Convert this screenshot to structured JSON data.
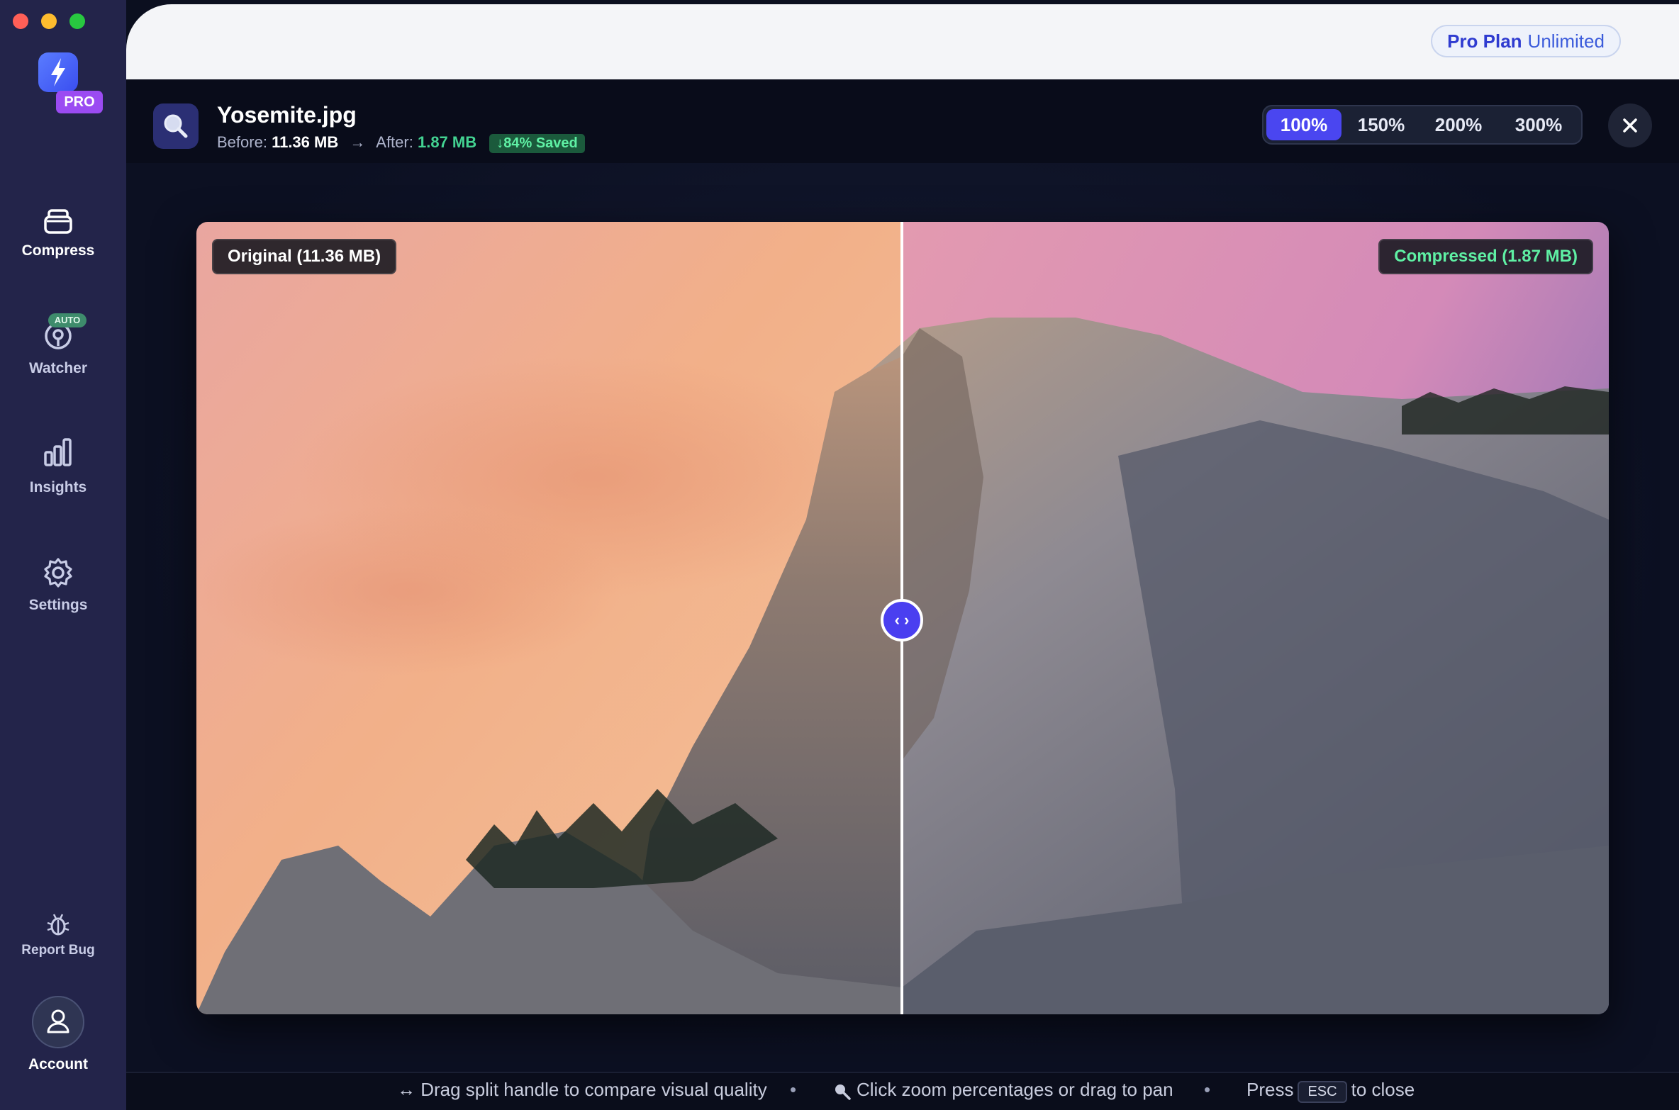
{
  "app": {
    "pro_badge": "PRO",
    "plan_name": "Pro Plan",
    "plan_tier": "Unlimited"
  },
  "sidebar": {
    "items": [
      {
        "label": "Compress",
        "icon": "stack-icon",
        "active": true
      },
      {
        "label": "Watcher",
        "icon": "watcher-icon",
        "badge": "AUTO"
      },
      {
        "label": "Insights",
        "icon": "bar-chart-icon"
      },
      {
        "label": "Settings",
        "icon": "gear-icon"
      }
    ],
    "bottom": [
      {
        "label": "Report Bug",
        "icon": "bug-icon"
      },
      {
        "label": "Account",
        "icon": "user-icon"
      }
    ]
  },
  "file": {
    "name": "Yosemite.jpg",
    "before_label": "Before:",
    "before_size": "11.36 MB",
    "arrow": "→",
    "after_label": "After:",
    "after_size": "1.87 MB",
    "saved": "↓84% Saved"
  },
  "zoom": {
    "options": [
      "100%",
      "150%",
      "200%",
      "300%"
    ],
    "selected": "100%"
  },
  "compare": {
    "original_label": "Original (11.36 MB)",
    "compressed_label": "Compressed (1.87 MB)",
    "handle_glyph": "‹ ›"
  },
  "footer": {
    "hint_drag": "↔ Drag split handle to compare visual quality",
    "hint_zoom": "Click zoom percentages or drag to pan",
    "hint_press": "Press",
    "esc_key": "ESC",
    "hint_close": "to close",
    "separator": "•"
  },
  "colors": {
    "sidebar_bg": "#23244a",
    "accent": "#4a46f0",
    "success": "#43d392",
    "pro_badge": "#9b4bf2"
  }
}
